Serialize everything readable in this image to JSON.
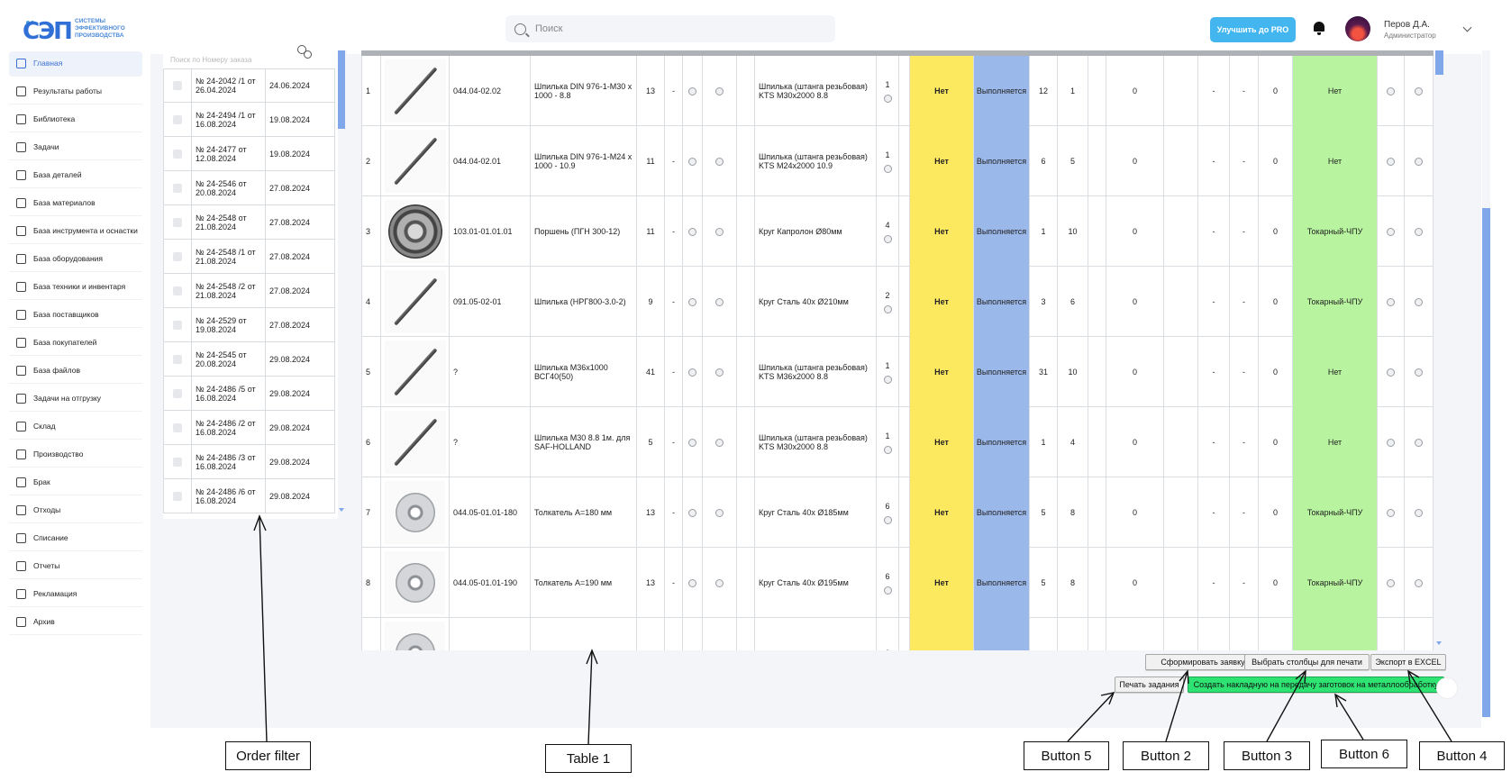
{
  "header": {
    "logo_text": "СЭП",
    "logo_subtitle_line1": "системы",
    "logo_subtitle_line2": "эффективного",
    "logo_subtitle_line3": "производства",
    "search_placeholder": "Поиск",
    "pro_button": "Улучшить до PRO",
    "user_name": "Перов Д.А.",
    "user_role": "Администратор"
  },
  "sidebar": {
    "items": [
      {
        "label": "Главная",
        "active": true
      },
      {
        "label": "Результаты работы"
      },
      {
        "label": "Библиотека"
      },
      {
        "label": "Задачи"
      },
      {
        "label": "База деталей"
      },
      {
        "label": "База материалов"
      },
      {
        "label": "База инструмента и оснастки"
      },
      {
        "label": "База оборудования"
      },
      {
        "label": "База техники и инвентаря"
      },
      {
        "label": "База поставщиков"
      },
      {
        "label": "База покупателей"
      },
      {
        "label": "База файлов"
      },
      {
        "label": "Задачи на отгрузку"
      },
      {
        "label": "Склад"
      },
      {
        "label": "Производство"
      },
      {
        "label": "Брак"
      },
      {
        "label": "Отходы"
      },
      {
        "label": "Списание"
      },
      {
        "label": "Отчеты"
      },
      {
        "label": "Рекламация"
      },
      {
        "label": "Архив"
      }
    ]
  },
  "order_filter": {
    "search_placeholder": "Поиск по Номеру заказа",
    "orders": [
      {
        "number": "№ 24-2042 /1 от 26.04.2024",
        "date": "24.06.2024"
      },
      {
        "number": "№ 24-2494 /1 от 16.08.2024",
        "date": "19.08.2024"
      },
      {
        "number": "№ 24-2477 от 12.08.2024",
        "date": "19.08.2024"
      },
      {
        "number": "№ 24-2546 от 20.08.2024",
        "date": "27.08.2024"
      },
      {
        "number": "№ 24-2548 от 21.08.2024",
        "date": "27.08.2024"
      },
      {
        "number": "№ 24-2548 /1 от 21.08.2024",
        "date": "27.08.2024"
      },
      {
        "number": "№ 24-2548 /2 от 21.08.2024",
        "date": "27.08.2024"
      },
      {
        "number": "№ 24-2529 от 19.08.2024",
        "date": "27.08.2024"
      },
      {
        "number": "№ 24-2545 от 20.08.2024",
        "date": "29.08.2024"
      },
      {
        "number": "№ 24-2486 /5 от 16.08.2024",
        "date": "29.08.2024"
      },
      {
        "number": "№ 24-2486 /2 от 16.08.2024",
        "date": "29.08.2024"
      },
      {
        "number": "№ 24-2486 /3 от 16.08.2024",
        "date": "29.08.2024"
      },
      {
        "number": "№ 24-2486 /6 от 16.08.2024",
        "date": "29.08.2024"
      }
    ]
  },
  "table": {
    "rows": [
      {
        "n": "1",
        "img": "rod",
        "code": "044.04-02.02",
        "name": "Шпилька DIN 976-1-M30 x 1000 - 8.8",
        "qty": "13",
        "dash": "-",
        "material": "Шпилька (штанга резьбовая) KTS M30x2000 8.8",
        "mqty": "1",
        "avail": "Нет",
        "status": "Выполняется",
        "a": "12",
        "b": "1",
        "c": "0",
        "d": "-",
        "e": "-",
        "f": "0",
        "op": "Нет"
      },
      {
        "n": "2",
        "img": "rod",
        "code": "044.04-02.01",
        "name": "Шпилька DIN 976-1-M24 x 1000 - 10.9",
        "qty": "11",
        "dash": "-",
        "material": "Шпилька (штанга резьбовая) KTS M24x2000 10.9",
        "mqty": "1",
        "avail": "Нет",
        "status": "Выполняется",
        "a": "6",
        "b": "5",
        "c": "0",
        "d": "-",
        "e": "-",
        "f": "0",
        "op": "Нет"
      },
      {
        "n": "3",
        "img": "gear",
        "code": "103.01-01.01.01",
        "name": "Поршень (ПГН 300-12)",
        "qty": "11",
        "dash": "-",
        "material": "Круг Капролон Ø80мм",
        "mqty": "4",
        "avail": "Нет",
        "status": "Выполняется",
        "a": "1",
        "b": "10",
        "c": "0",
        "d": "-",
        "e": "-",
        "f": "0",
        "op": "Токарный-ЧПУ"
      },
      {
        "n": "4",
        "img": "rod",
        "code": "091.05-02-01",
        "name": "Шпилька (НРГ800-3.0-2)",
        "qty": "9",
        "dash": "-",
        "material": "Круг Сталь 40х Ø210мм",
        "mqty": "2",
        "avail": "Нет",
        "status": "Выполняется",
        "a": "3",
        "b": "6",
        "c": "0",
        "d": "-",
        "e": "-",
        "f": "0",
        "op": "Токарный-ЧПУ"
      },
      {
        "n": "5",
        "img": "rod",
        "code": "?",
        "name": "Шпилька М36х1000 ВСГ40(50)",
        "qty": "41",
        "dash": "-",
        "material": "Шпилька (штанга резьбовая) KTS M36x2000 8.8",
        "mqty": "1",
        "avail": "Нет",
        "status": "Выполняется",
        "a": "31",
        "b": "10",
        "c": "0",
        "d": "-",
        "e": "-",
        "f": "0",
        "op": "Нет"
      },
      {
        "n": "6",
        "img": "rod",
        "code": "?",
        "name": "Шпилька М30 8.8 1м. для SAF-HOLLAND",
        "qty": "5",
        "dash": "-",
        "material": "Шпилька (штанга резьбовая) KTS M30x2000 8.8",
        "mqty": "1",
        "avail": "Нет",
        "status": "Выполняется",
        "a": "1",
        "b": "4",
        "c": "0",
        "d": "-",
        "e": "-",
        "f": "0",
        "op": "Нет"
      },
      {
        "n": "7",
        "img": "disk",
        "code": "044.05-01.01-180",
        "name": "Толкатель А=180 мм",
        "qty": "13",
        "dash": "-",
        "material": "Круг Сталь 40х Ø185мм",
        "mqty": "6",
        "avail": "Нет",
        "status": "Выполняется",
        "a": "5",
        "b": "8",
        "c": "0",
        "d": "-",
        "e": "-",
        "f": "0",
        "op": "Токарный-ЧПУ"
      },
      {
        "n": "8",
        "img": "disk",
        "code": "044.05-01.01-190",
        "name": "Толкатель А=190 мм",
        "qty": "13",
        "dash": "-",
        "material": "Круг Сталь 40х Ø195мм",
        "mqty": "6",
        "avail": "Нет",
        "status": "Выполняется",
        "a": "5",
        "b": "8",
        "c": "0",
        "d": "-",
        "e": "-",
        "f": "0",
        "op": "Токарный-ЧПУ"
      },
      {
        "n": "",
        "img": "disk",
        "code": "",
        "name": "",
        "qty": "",
        "dash": "",
        "material": "",
        "mqty": "6",
        "avail": "",
        "status": "",
        "a": "",
        "b": "",
        "c": "",
        "d": "",
        "e": "",
        "f": "",
        "op": ""
      }
    ]
  },
  "buttons": {
    "form_request": "Сформировать заявку",
    "choose_columns": "Выбрать столбцы для печати",
    "export_excel": "Экспорт в EXCEL",
    "print_task": "Печать задания",
    "create_invoice": "Создать накладную на передачу заготовок на металлообработку"
  },
  "annotations": {
    "order_filter": "Order filter",
    "table_1": "Table 1",
    "button_5": "Button 5",
    "button_2": "Button 2",
    "button_3": "Button 3",
    "button_6": "Button 6",
    "button_4": "Button 4"
  },
  "colors": {
    "accent": "#43b6f0",
    "availability_bg": "#fde95f",
    "status_bg": "#9bb8ea",
    "operation_bg": "#b8f39f",
    "create_button": "#2ee372"
  }
}
